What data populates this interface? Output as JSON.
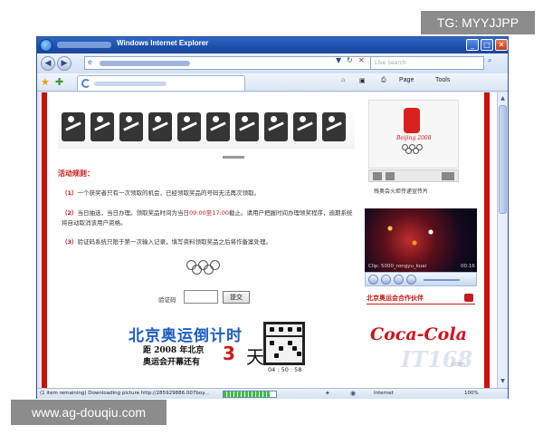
{
  "overlays": {
    "top_right_tag": "TG: MYYJJPP",
    "bottom_left_tag": "www.ag-douqiu.com"
  },
  "window": {
    "title": "Windows Internet Explorer",
    "buttons": [
      "_",
      "□",
      "✕"
    ]
  },
  "address_bar": {
    "back_icon": "back-arrow-icon",
    "forward_icon": "forward-arrow-icon",
    "search_placeholder": "Live Search"
  },
  "command_bar": {
    "page_label": "Page",
    "tools_label": "Tools"
  },
  "page": {
    "rules_title": "活动规则：",
    "rules": [
      {
        "num": "（1）",
        "text": "一个获奖者只有一次领取的机会，已经领取奖品的号码无法再次领取。"
      },
      {
        "num": "（2）",
        "text_pre": "当日抽选，当日办理。领取奖品时间为当日",
        "time": "09:00至17:00",
        "text_post": "截止。请用户把握时间办理领奖程序，逾期系统将自动取消该用户资格。"
      },
      {
        "num": "（3）",
        "text": "验证码系统只限于第一次输入记录，填写资料领取奖品之后将作备案处理。"
      }
    ],
    "code_label": "验证码",
    "code_button": "提交",
    "countdown_title": "北京奥运倒计时",
    "countdown_line1": "距 2008 年北京",
    "countdown_line2": "奥运会开幕还有",
    "countdown_number": "3",
    "countdown_day": "天",
    "countdown_time": "04 : 50 : 58"
  },
  "sidebar": {
    "logo_text": "Beijing 2008",
    "caption": "残奥会火炬传递宣传片",
    "video_caption": "Clip: 5000_rongyu_kuai",
    "video_time": "00:16",
    "partner_title": "北京奥运会合作伙伴",
    "sponsor": "Coca-Cola",
    "watermark": "IT168",
    "watermark_small": "com"
  },
  "status_bar": {
    "status_text": "(1 item remaining) Downloading picture http://285929886.007boy...",
    "zone": "Internet",
    "zoom": "100%",
    "progress": 0.9
  },
  "colors": {
    "accent_red": "#cc1010",
    "title_blue": "#1d5ebf"
  }
}
